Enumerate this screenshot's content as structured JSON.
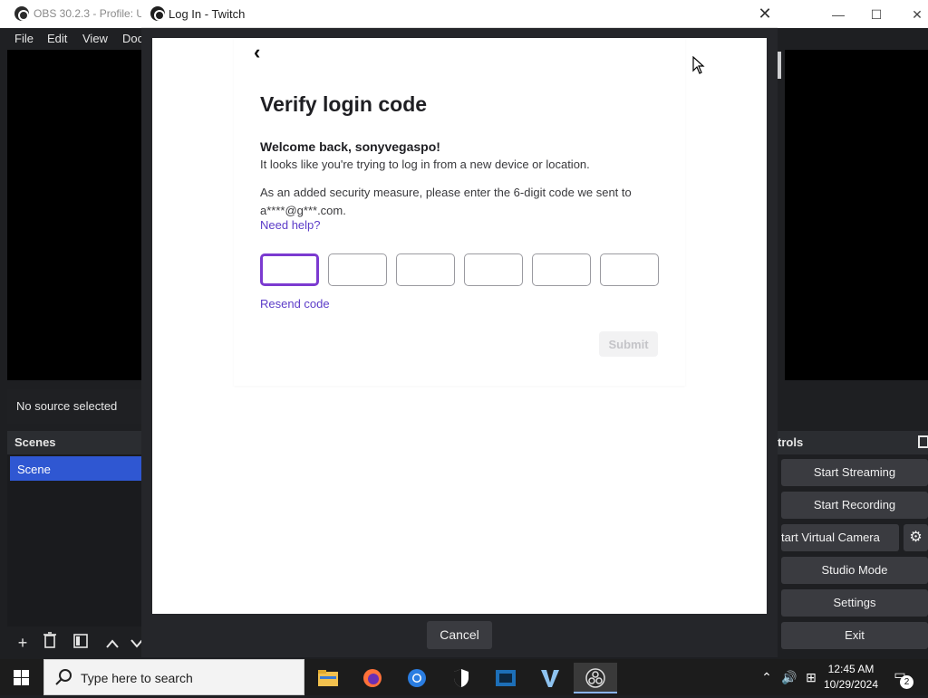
{
  "obs": {
    "title": "OBS 30.2.3 - Profile: Ur",
    "menu": [
      "File",
      "Edit",
      "View",
      "Doc"
    ],
    "no_source": "No source selected",
    "scenes_header": "Scenes",
    "scene_item": "Scene",
    "controls_header": "trols",
    "controls": [
      "Start Streaming",
      "Start Recording",
      "tart Virtual Camera",
      "Studio Mode",
      "Settings",
      "Exit"
    ],
    "window_controls": {
      "minimize": "—",
      "maximize": "☐",
      "close": "✕"
    }
  },
  "modal": {
    "title": "Log In - Twitch",
    "close": "✕",
    "cancel": "Cancel"
  },
  "verify": {
    "back": "‹",
    "heading": "Verify login code",
    "welcome": "Welcome back, sonyvegaspo!",
    "line1": "It looks like you're trying to log in from a new device or location.",
    "line2": "As an added security measure, please enter the 6-digit code we sent to a****@g***.com.",
    "help": "Need help?",
    "digits": [
      "",
      "",
      "",
      "",
      "",
      ""
    ],
    "resend": "Resend code",
    "submit": "Submit"
  },
  "taskbar": {
    "search_placeholder": "Type here to search",
    "time": "12:45 AM",
    "date": "10/29/2024",
    "notifications": "2"
  },
  "colors": {
    "accent_purple": "#7b3ad0",
    "link_purple": "#5c3cc8",
    "scene_selected": "#2f57d2"
  }
}
